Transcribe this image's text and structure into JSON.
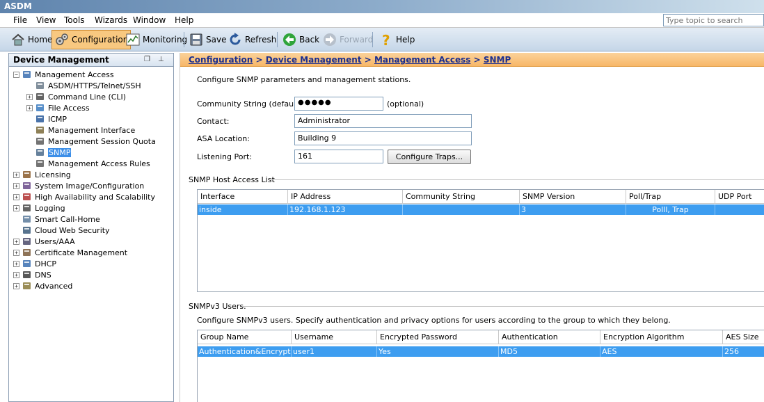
{
  "window": {
    "title": "ASDM"
  },
  "menu": [
    "File",
    "View",
    "Tools",
    "Wizards",
    "Window",
    "Help"
  ],
  "search": {
    "placeholder": "Type topic to search"
  },
  "toolbar": {
    "home": "Home",
    "configuration": "Configuration",
    "monitoring": "Monitoring",
    "save": "Save",
    "refresh": "Refresh",
    "back": "Back",
    "forward": "Forward",
    "help": "Help"
  },
  "left_panel": {
    "title": "Device Management",
    "tree": [
      {
        "label": "Management Access",
        "expander": "−",
        "icon": "management-access-icon"
      },
      {
        "label": "ASDM/HTTPS/Telnet/SSH",
        "icon": "asdm-icon"
      },
      {
        "label": "Command Line (CLI)",
        "expander": "+",
        "icon": "cli-icon"
      },
      {
        "label": "File Access",
        "expander": "+",
        "icon": "file-access-icon"
      },
      {
        "label": "ICMP",
        "icon": "icmp-icon"
      },
      {
        "label": "Management Interface",
        "icon": "management-interface-icon"
      },
      {
        "label": "Management Session Quota",
        "icon": "session-quota-icon"
      },
      {
        "label": "SNMP",
        "icon": "snmp-icon",
        "selected": true
      },
      {
        "label": "Management Access Rules",
        "icon": "access-rules-icon"
      },
      {
        "label": "Licensing",
        "expander": "+",
        "icon": "licensing-icon"
      },
      {
        "label": "System Image/Configuration",
        "expander": "+",
        "icon": "system-image-icon"
      },
      {
        "label": "High Availability and Scalability",
        "expander": "+",
        "icon": "high-availability-icon"
      },
      {
        "label": "Logging",
        "expander": "+",
        "icon": "logging-icon"
      },
      {
        "label": "Smart Call-Home",
        "icon": "smart-call-home-icon"
      },
      {
        "label": "Cloud Web Security",
        "icon": "cloud-web-security-icon"
      },
      {
        "label": "Users/AAA",
        "expander": "+",
        "icon": "users-aaa-icon"
      },
      {
        "label": "Certificate Management",
        "expander": "+",
        "icon": "certificate-icon"
      },
      {
        "label": "DHCP",
        "expander": "+",
        "icon": "dhcp-icon"
      },
      {
        "label": "DNS",
        "expander": "+",
        "icon": "dns-icon"
      },
      {
        "label": "Advanced",
        "expander": "+",
        "icon": "advanced-icon"
      }
    ]
  },
  "breadcrumb": {
    "configuration": "Configuration",
    "sep": ">",
    "device_management": "Device Management",
    "management_access": "Management Access",
    "snmp": "SNMP"
  },
  "snmp": {
    "description": "Configure SNMP parameters and management stations.",
    "community_label": "Community String (default):",
    "community_value": "●●●●●",
    "optional": "(optional)",
    "contact_label": "Contact:",
    "contact_value": "Administrator",
    "location_label": "ASA Location:",
    "location_value": "Building 9",
    "port_label": "Listening Port:",
    "port_value": "161",
    "configure_traps": "Configure Traps..."
  },
  "host_access": {
    "title": "SNMP Host Access List",
    "columns": [
      "Interface",
      "IP Address",
      "Community String",
      "SNMP Version",
      "Poll/Trap",
      "UDP Port"
    ],
    "rows": [
      [
        "inside",
        "192.168.1.123",
        "",
        "3",
        "Polll, Trap",
        ""
      ]
    ]
  },
  "snmpv3": {
    "title": "SNMPv3 Users.",
    "description": "Configure SNMPv3 users. Specify authentication and privacy options for users according to the group to which they belong.",
    "columns": [
      "Group Name",
      "Username",
      "Encrypted Password",
      "Authentication",
      "Encryption Algorithm",
      "AES Size"
    ],
    "rows": [
      [
        "Authentication&Encryption",
        "user1",
        "Yes",
        "MD5",
        "AES",
        "256"
      ]
    ]
  }
}
